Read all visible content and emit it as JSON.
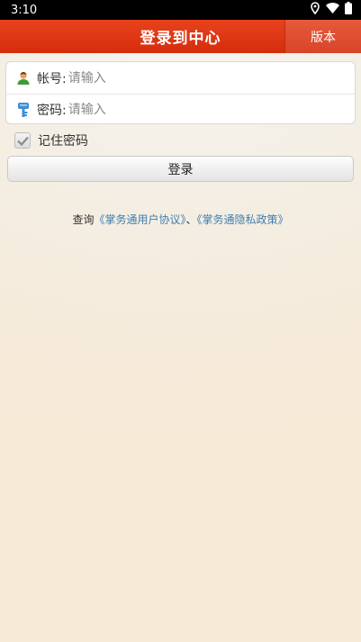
{
  "status_bar": {
    "time": "3:10",
    "icons": [
      "location-icon",
      "wifi-icon",
      "battery-icon"
    ]
  },
  "header": {
    "title": "登录到中心",
    "version_label": "版本",
    "colors": {
      "bar": "#d8360f"
    }
  },
  "form": {
    "account": {
      "label": "帐号:",
      "placeholder": "请输入",
      "value": "",
      "icon": "user-icon"
    },
    "password": {
      "label": "密码:",
      "placeholder": "请输入",
      "value": "",
      "icon": "key-icon"
    }
  },
  "remember": {
    "label": "记住密码",
    "checked": true
  },
  "login_button": {
    "label": "登录"
  },
  "agreement": {
    "prefix": "查询",
    "user_agreement": "《掌务通用户协议》",
    "separator": "、",
    "privacy_policy": "《掌务通隐私政策》",
    "link_color": "#3e7fb0"
  }
}
